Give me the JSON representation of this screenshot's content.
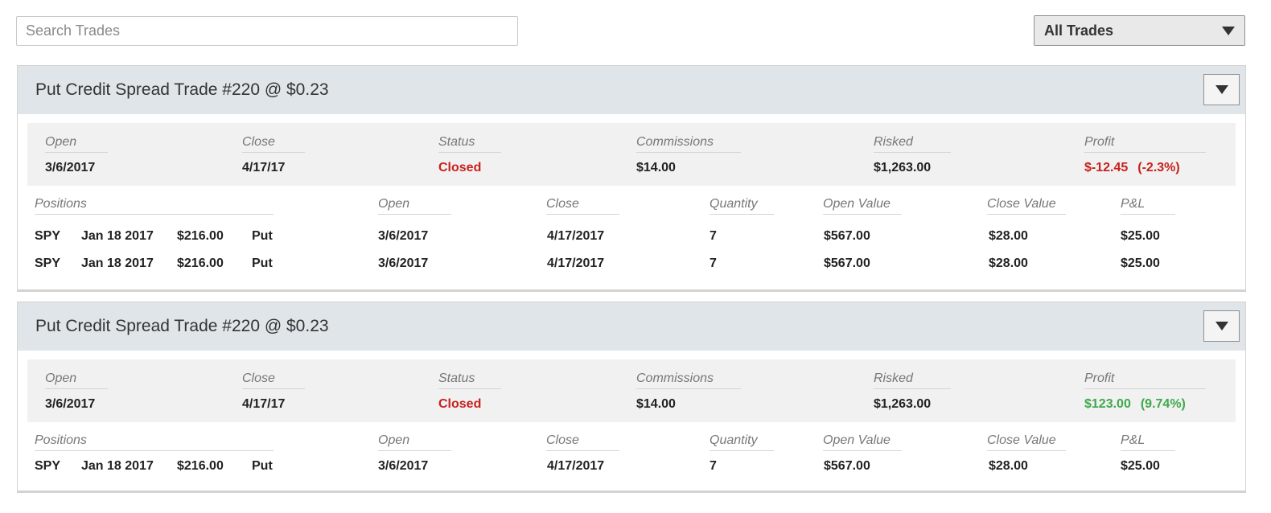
{
  "search": {
    "placeholder": "Search Trades",
    "value": ""
  },
  "filter": {
    "selected": "All Trades"
  },
  "labels": {
    "open": "Open",
    "close": "Close",
    "status": "Status",
    "commissions": "Commissions",
    "risked": "Risked",
    "profit": "Profit",
    "positions": "Positions",
    "quantity": "Quantity",
    "open_value": "Open Value",
    "close_value": "Close Value",
    "pnl": "P&L"
  },
  "trades": [
    {
      "title": "Put Credit Spread Trade #220 @ $0.23",
      "open": "3/6/2017",
      "close": "4/17/17",
      "status": "Closed",
      "commissions": "$14.00",
      "risked": "$1,263.00",
      "profit": "$-12.45",
      "profit_pct": "(-2.3%)",
      "profit_state": "loss",
      "positions": [
        {
          "symbol": "SPY",
          "expiry": "Jan 18 2017",
          "strike": "$216.00",
          "type": "Put",
          "open": "3/6/2017",
          "close": "4/17/2017",
          "quantity": "7",
          "open_value": "$567.00",
          "close_value": "$28.00",
          "pnl": "$25.00"
        },
        {
          "symbol": "SPY",
          "expiry": "Jan 18 2017",
          "strike": "$216.00",
          "type": "Put",
          "open": "3/6/2017",
          "close": "4/17/2017",
          "quantity": "7",
          "open_value": "$567.00",
          "close_value": "$28.00",
          "pnl": "$25.00"
        }
      ]
    },
    {
      "title": "Put Credit Spread Trade #220 @ $0.23",
      "open": "3/6/2017",
      "close": "4/17/17",
      "status": "Closed",
      "commissions": "$14.00",
      "risked": "$1,263.00",
      "profit": "$123.00",
      "profit_pct": "(9.74%)",
      "profit_state": "gain",
      "positions": [
        {
          "symbol": "SPY",
          "expiry": "Jan 18 2017",
          "strike": "$216.00",
          "type": "Put",
          "open": "3/6/2017",
          "close": "4/17/2017",
          "quantity": "7",
          "open_value": "$567.00",
          "close_value": "$28.00",
          "pnl": "$25.00"
        }
      ]
    }
  ],
  "colors": {
    "loss": "#c8211c",
    "gain": "#3fa94b",
    "header_bg": "#e0e5e9",
    "summary_bg": "#f1f1f1"
  },
  "icons": {
    "toggle": "triangle-down-icon",
    "filter": "triangle-down-icon"
  }
}
